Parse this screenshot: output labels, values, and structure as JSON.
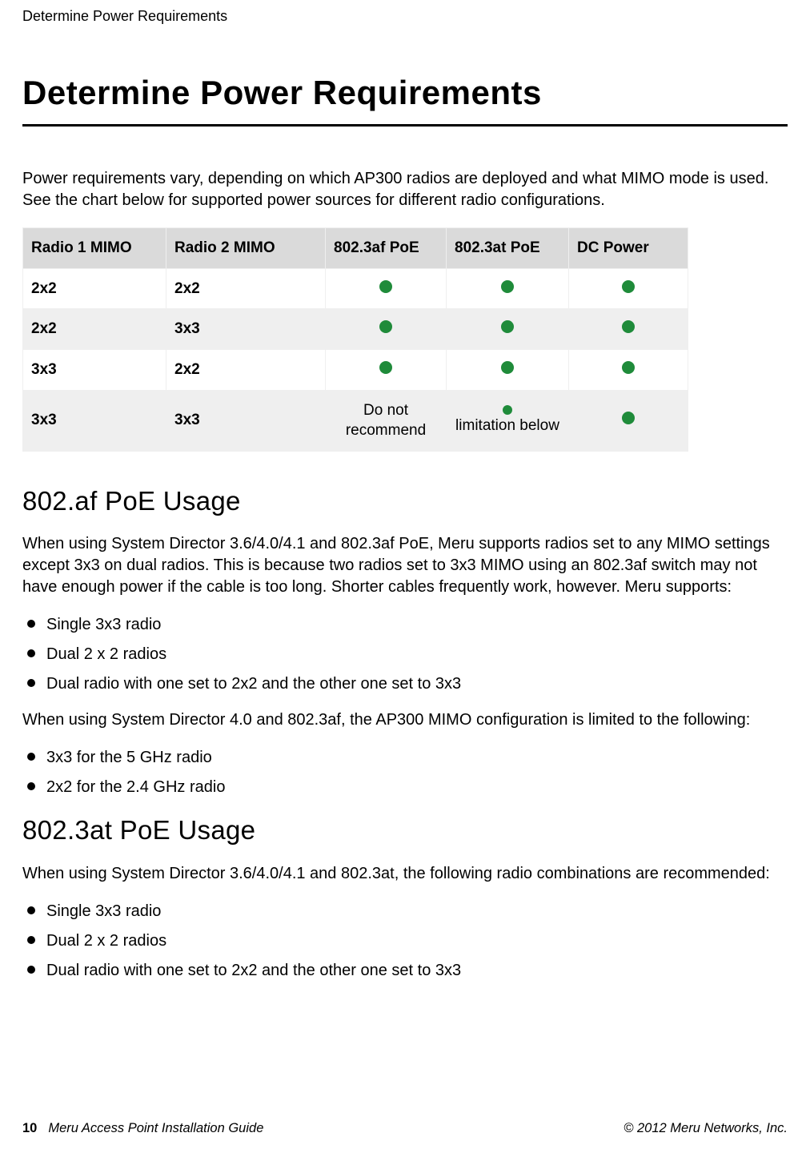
{
  "running_head": "Determine Power Requirements",
  "main_heading": "Determine Power Requirements",
  "intro_para": "Power requirements vary, depending on which AP300 radios are deployed and what MIMO mode is used. See the chart below for supported power sources for different radio configurations.",
  "table": {
    "headers": {
      "r1": "Radio 1 MIMO",
      "r2": "Radio 2 MIMO",
      "af": "802.3af PoE",
      "at": "802.3at PoE",
      "dc": "DC Power"
    },
    "rows": [
      {
        "r1": "2x2",
        "r2": "2x2",
        "af": "dot",
        "at": "dot",
        "dc": "dot"
      },
      {
        "r1": "2x2",
        "r2": "3x3",
        "af": "dot",
        "at": "dot",
        "dc": "dot"
      },
      {
        "r1": "3x3",
        "r2": "2x2",
        "af": "dot",
        "at": "dot",
        "dc": "dot"
      },
      {
        "r1": "3x3",
        "r2": "3x3",
        "af_text": "Do not recommend",
        "at_text": "limitation below",
        "at_dot": true,
        "dc": "dot"
      }
    ]
  },
  "section_af": {
    "heading": "802.af PoE Usage",
    "para1": "When using System Director 3.6/4.0/4.1 and 802.3af PoE, Meru supports radios set to any MIMO settings except 3x3 on dual radios. This is because two radios set to 3x3 MIMO using an 802.3af switch may not have enough power if the cable is too long. Shorter cables frequently work, however. Meru supports:",
    "list1": [
      "Single 3x3 radio",
      "Dual 2 x 2 radios",
      "Dual radio with one set to 2x2 and the other one set to 3x3"
    ],
    "para2": "When using System Director 4.0 and 802.3af, the AP300 MIMO configuration is limited to the following:",
    "list2": [
      "3x3 for the 5 GHz radio",
      "2x2 for the 2.4 GHz radio"
    ]
  },
  "section_at": {
    "heading": "802.3at PoE Usage",
    "para1": "When using System Director 3.6/4.0/4.1 and 802.3at, the following radio combinations are recommended:",
    "list1": [
      "Single 3x3 radio",
      "Dual 2 x 2 radios",
      "Dual radio with one set to 2x2 and the other one set to 3x3"
    ]
  },
  "footer": {
    "page_number": "10",
    "doc_title": "Meru Access Point Installation Guide",
    "copyright": "© 2012 Meru Networks, Inc."
  },
  "colors": {
    "dot": "#1f8b3a"
  }
}
